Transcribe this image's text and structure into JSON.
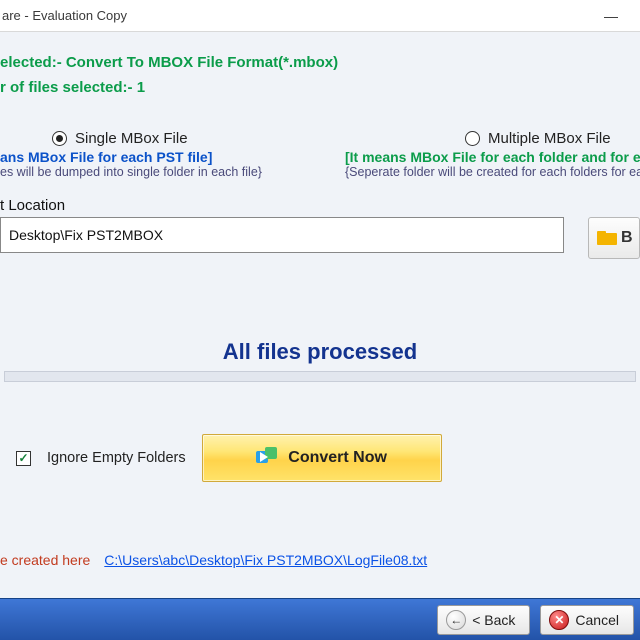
{
  "window": {
    "title": "are - Evaluation Copy"
  },
  "summary": {
    "format_line": "elected:- Convert To MBOX File Format(*.mbox)",
    "count_line": "r of files selected:- 1"
  },
  "options": {
    "single": {
      "label": "Single MBox File",
      "subtitle": "ans MBox File for each PST file]",
      "note": "es will be dumped into single folder in each file}",
      "selected": true
    },
    "multiple": {
      "label": "Multiple MBox File",
      "subtitle": "[It means MBox File for each folder and for ea",
      "note": "{Seperate folder will be created for each folders for ea",
      "selected": false
    }
  },
  "output": {
    "label": "t Location",
    "path": "Desktop\\Fix PST2MBOX",
    "browse_label": "B"
  },
  "progress": {
    "status": "All files processed"
  },
  "actions": {
    "ignore_empty_label": "Ignore Empty Folders",
    "ignore_empty_checked": true,
    "convert_label": "Convert Now"
  },
  "log": {
    "prefix": "e created here",
    "path": "C:\\Users\\abc\\Desktop\\Fix PST2MBOX\\LogFile08.txt"
  },
  "wizard": {
    "back": "< Back",
    "cancel": "Cancel"
  }
}
